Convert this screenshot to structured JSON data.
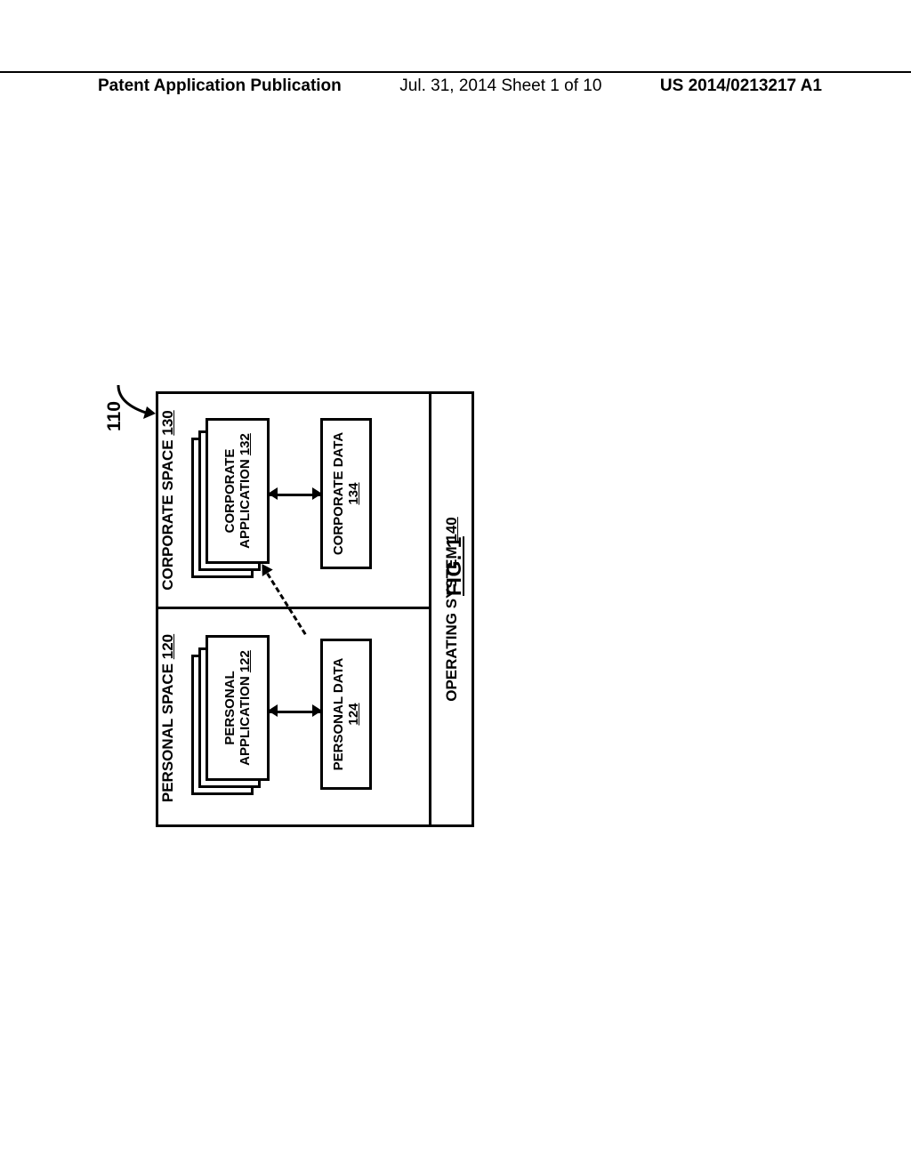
{
  "header": {
    "left": "Patent Application Publication",
    "mid": "Jul. 31, 2014  Sheet 1 of 10",
    "right": "US 2014/0213217 A1"
  },
  "figure_label": "FIG. 1",
  "ref_num": "110",
  "spaces": {
    "personal": {
      "title_text": "PERSONAL SPACE ",
      "title_num": "120",
      "app_text": "PERSONAL APPLICATION ",
      "app_num": "122",
      "data_text": "PERSONAL DATA ",
      "data_num": "124"
    },
    "corporate": {
      "title_text": "CORPORATE SPACE ",
      "title_num": "130",
      "app_text": "CORPORATE APPLICATION ",
      "app_num": "132",
      "data_text": "CORPORATE DATA ",
      "data_num": "134"
    }
  },
  "os": {
    "text": "OPERATING SYSTEM ",
    "num": "140"
  }
}
